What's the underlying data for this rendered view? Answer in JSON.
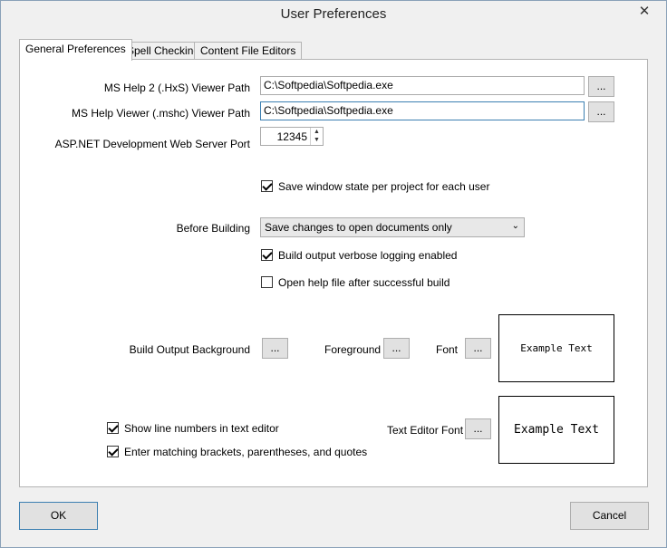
{
  "window": {
    "title": "User Preferences",
    "close_glyph": "✕"
  },
  "tabs": [
    {
      "label": "General Preferences",
      "active": true
    },
    {
      "label": "Spell Checking",
      "active": false
    },
    {
      "label": "Content File Editors",
      "active": false
    }
  ],
  "general": {
    "help2_label": "MS Help 2 (.HxS) Viewer Path",
    "help2_value": "C:\\Softpedia\\Softpedia.exe",
    "helpviewer_label": "MS Help Viewer (.mshc) Viewer Path",
    "helpviewer_value": "C:\\Softpedia\\Softpedia.exe",
    "browse_label": "...",
    "port_label": "ASP.NET Development Web Server Port",
    "port_value": "12345",
    "save_window_state_label": "Save window state per project for each user",
    "before_building_label": "Before Building",
    "before_building_value": "Save changes to open documents only",
    "verbose_logging_label": "Build output verbose logging enabled",
    "open_help_label": "Open help file after successful build",
    "build_bg_label": "Build Output Background",
    "foreground_label": "Foreground",
    "font_label": "Font",
    "build_preview_text": "Example Text",
    "show_line_numbers_label": "Show line numbers in text editor",
    "text_editor_font_label": "Text Editor Font",
    "matching_brackets_label": "Enter matching brackets, parentheses, and quotes",
    "editor_preview_text": "Example Text",
    "save_window_state_checked": true,
    "verbose_logging_checked": true,
    "open_help_checked": false,
    "show_line_numbers_checked": true,
    "matching_brackets_checked": true
  },
  "footer": {
    "ok_label": "OK",
    "cancel_label": "Cancel"
  }
}
